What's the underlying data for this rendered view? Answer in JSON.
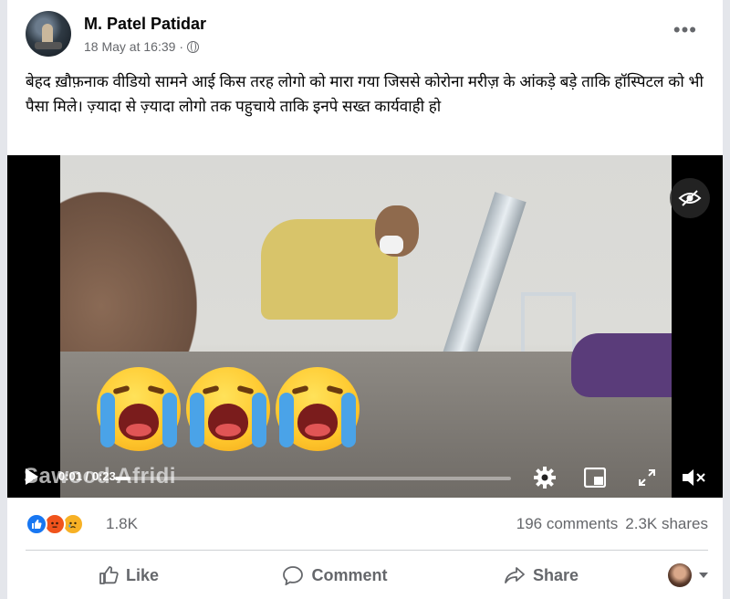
{
  "post": {
    "author": "M. Patel Patidar",
    "timestamp": "18 May at 16:39",
    "separator": "·",
    "audience_icon": "globe-icon",
    "more_label": "•••",
    "text": "बेहद ख़ौफ़नाक वीडियो सामने आई किस तरह  लोगो को मारा गया जिससे कोरोना मरीज़ के आंकड़े बड़े ताकि हॉस्पिटल को भी पैसा मिले। ज़्यादा से ज़्यादा लोगो तक पहुचाये ताकि इनपे सख्त कार्यवाही हो"
  },
  "video": {
    "watermark": "Sawood Afridi",
    "time": "0:01 / 0:23",
    "progress": 0.04,
    "icons": [
      "eye-slash-icon",
      "play-icon",
      "settings-icon",
      "picture-in-picture-icon",
      "fullscreen-icon",
      "muted-volume-icon"
    ]
  },
  "stats": {
    "reaction_icons": [
      "like-icon",
      "angry-icon",
      "sad-icon"
    ],
    "reaction_count": "1.8K",
    "comments": "196 comments",
    "shares": "2.3K shares"
  },
  "actions": {
    "like": "Like",
    "comment": "Comment",
    "share": "Share"
  },
  "colors": {
    "like_blue": "#1877f2",
    "angry_orange": "#f0531c",
    "sad_yellow": "#f7b125",
    "text_secondary": "#65676b"
  }
}
